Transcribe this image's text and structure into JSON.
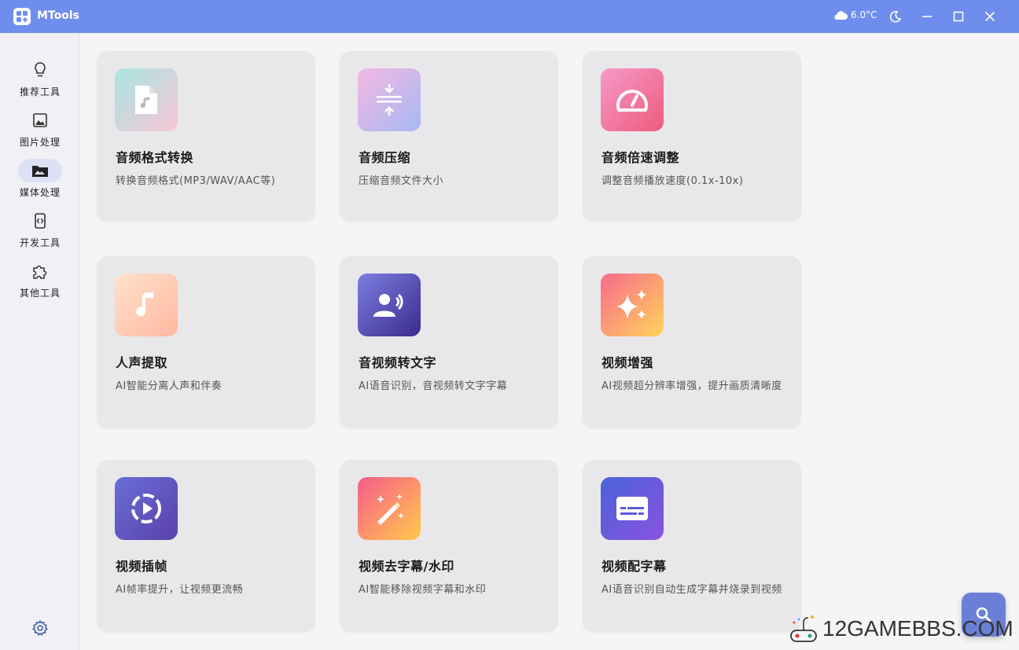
{
  "window": {
    "title": "MTools",
    "weather": "6.0°C"
  },
  "sidebar": {
    "items": [
      {
        "label": "推荐工具",
        "icon": "lightbulb-icon"
      },
      {
        "label": "图片处理",
        "icon": "image-icon"
      },
      {
        "label": "媒体处理",
        "icon": "media-folder-icon",
        "active": true
      },
      {
        "label": "开发工具",
        "icon": "code-icon"
      },
      {
        "label": "其他工具",
        "icon": "puzzle-icon"
      }
    ],
    "settings_icon": "gear-icon"
  },
  "cards": [
    {
      "title": "音频格式转换",
      "desc": "转换音频格式(MP3/WAV/AAC等)",
      "icon": "audio-file-icon"
    },
    {
      "title": "音频压缩",
      "desc": "压缩音频文件大小",
      "icon": "compress-icon"
    },
    {
      "title": "音频倍速调整",
      "desc": "调整音频播放速度(0.1x-10x)",
      "icon": "speedometer-icon"
    },
    {
      "title": "人声提取",
      "desc": "AI智能分离人声和伴奏",
      "icon": "music-note-icon"
    },
    {
      "title": "音视频转文字",
      "desc": "AI语音识别，音视频转文字字幕",
      "icon": "voice-person-icon"
    },
    {
      "title": "视频增强",
      "desc": "AI视频超分辨率增强，提升画质清晰度",
      "icon": "sparkle-icon"
    },
    {
      "title": "视频插帧",
      "desc": "AI帧率提升，让视频更流畅",
      "icon": "play-circle-icon"
    },
    {
      "title": "视频去字幕/水印",
      "desc": "AI智能移除视频字幕和水印",
      "icon": "magic-wand-icon"
    },
    {
      "title": "视频配字幕",
      "desc": "AI语音识别自动生成字幕并烧录到视频",
      "icon": "subtitles-icon"
    }
  ],
  "fab": {
    "icon": "search-icon"
  },
  "watermark": {
    "text": "12GAMEBBS.COM"
  },
  "colors": {
    "titlebar": "#6f8ded",
    "accent": "#6b7fd6"
  }
}
